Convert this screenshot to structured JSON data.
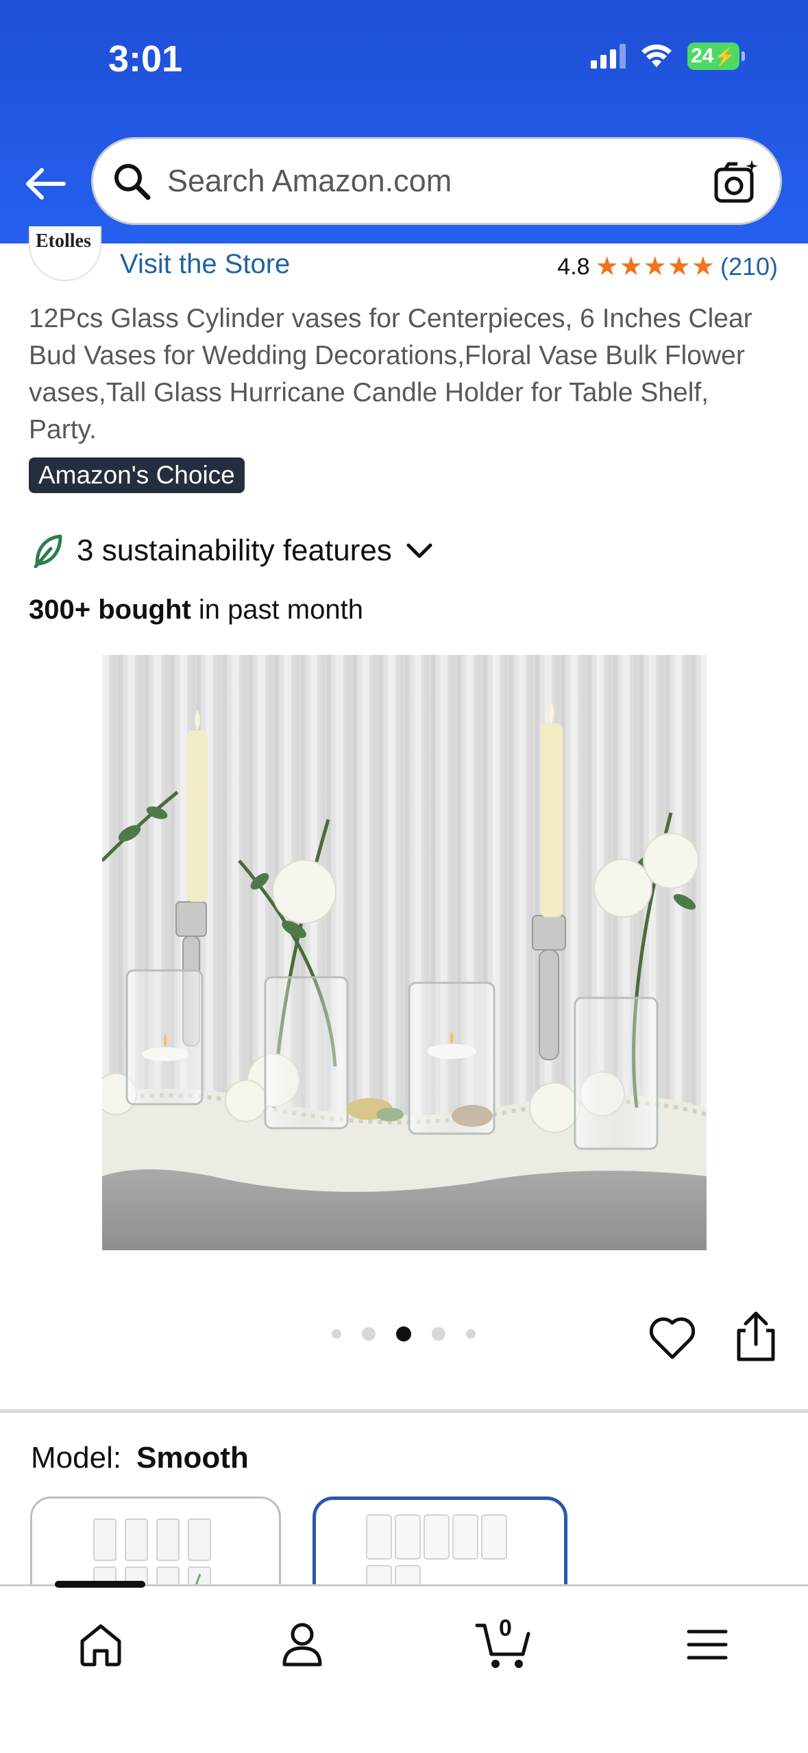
{
  "status_bar": {
    "time": "3:01",
    "battery": "24"
  },
  "search": {
    "placeholder": "Search Amazon.com"
  },
  "store": {
    "logo_text": "Etolles",
    "visit_label": "Visit the Store"
  },
  "rating": {
    "value": "4.8",
    "stars": 4.8,
    "review_count": "(210)"
  },
  "product": {
    "title": "12Pcs Glass Cylinder vases for Centerpieces, 6 Inches Clear Bud Vases for Wedding Decorations,Floral Vase Bulk Flower vases,Tall Glass Hurricane Candle Holder for Table Shelf, Party.",
    "badge": "Amazon's Choice",
    "sustainability": "3 sustainability features",
    "bought_bold": "300+ bought",
    "bought_rest": " in past month"
  },
  "gallery": {
    "image_count": 5,
    "active_index": 2
  },
  "model": {
    "label": "Model:",
    "value": "Smooth"
  },
  "bottom_nav": {
    "cart_count": "0"
  },
  "colors": {
    "header": "#2660ef",
    "link": "#2162a1",
    "star": "#f1731f",
    "badge_bg": "#232f3e",
    "selected_border": "#2a5aa8"
  }
}
